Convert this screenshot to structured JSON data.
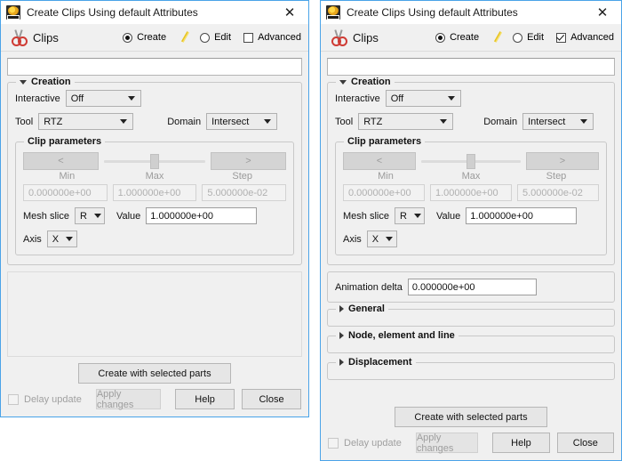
{
  "window_left": {
    "title": "Create Clips Using default Attributes",
    "app_icon": "app-emblem-icon",
    "close_icon": "✕",
    "header": {
      "tool_icon": "scissors-icon",
      "tool_label": "Clips",
      "create_label": "Create",
      "create_selected": true,
      "pencil_icon": "pencil-icon",
      "edit_label": "Edit",
      "edit_selected": false,
      "advanced_label": "Advanced",
      "advanced_checked": false
    },
    "name_field_value": "",
    "creation": {
      "title": "Creation",
      "expanded": true,
      "interactive_label": "Interactive",
      "interactive_value": "Off",
      "tool_label": "Tool",
      "tool_value": "RTZ",
      "domain_label": "Domain",
      "domain_value": "Intersect",
      "clip_parameters": {
        "title": "Clip parameters",
        "prev_label": "<",
        "next_label": ">",
        "min_label": "Min",
        "max_label": "Max",
        "step_label": "Step",
        "min_value": "0.000000e+00",
        "max_value": "1.000000e+00",
        "step_value": "5.000000e-02",
        "mesh_slice_label": "Mesh slice",
        "mesh_slice_value": "R",
        "value_label": "Value",
        "value_value": "1.000000e+00",
        "axis_label": "Axis",
        "axis_value": "X"
      }
    },
    "footer": {
      "create_with_selected_parts": "Create with selected parts",
      "delay_update_label": "Delay update",
      "delay_update_checked": false,
      "apply_changes_label": "Apply changes",
      "help_label": "Help",
      "close_label": "Close"
    }
  },
  "window_right": {
    "title": "Create Clips Using default Attributes",
    "app_icon": "app-emblem-icon",
    "close_icon": "✕",
    "header": {
      "tool_icon": "scissors-icon",
      "tool_label": "Clips",
      "create_label": "Create",
      "create_selected": true,
      "pencil_icon": "pencil-icon",
      "edit_label": "Edit",
      "edit_selected": false,
      "advanced_label": "Advanced",
      "advanced_checked": true
    },
    "name_field_value": "",
    "creation": {
      "title": "Creation",
      "expanded": true,
      "interactive_label": "Interactive",
      "interactive_value": "Off",
      "tool_label": "Tool",
      "tool_value": "RTZ",
      "domain_label": "Domain",
      "domain_value": "Intersect",
      "clip_parameters": {
        "title": "Clip parameters",
        "prev_label": "<",
        "next_label": ">",
        "min_label": "Min",
        "max_label": "Max",
        "step_label": "Step",
        "min_value": "0.000000e+00",
        "max_value": "1.000000e+00",
        "step_value": "5.000000e-02",
        "mesh_slice_label": "Mesh slice",
        "mesh_slice_value": "R",
        "value_label": "Value",
        "value_value": "1.000000e+00",
        "axis_label": "Axis",
        "axis_value": "X"
      }
    },
    "animation": {
      "delta_label": "Animation delta",
      "delta_value": "0.000000e+00"
    },
    "sections": [
      {
        "title": "General",
        "expanded": false
      },
      {
        "title": "Node, element and line",
        "expanded": false
      },
      {
        "title": "Displacement",
        "expanded": false
      }
    ],
    "footer": {
      "create_with_selected_parts": "Create with selected parts",
      "delay_update_label": "Delay update",
      "delay_update_checked": false,
      "apply_changes_label": "Apply changes",
      "help_label": "Help",
      "close_label": "Close"
    }
  },
  "colors": {
    "window_border": "#4aa3e8",
    "panel_bg": "#f0f0f0",
    "titlebar_bg": "#ffffff",
    "scissors_red": "#cf3b34",
    "pencil_yellow": "#e8c324",
    "disabled_text": "#a0a0a0"
  }
}
